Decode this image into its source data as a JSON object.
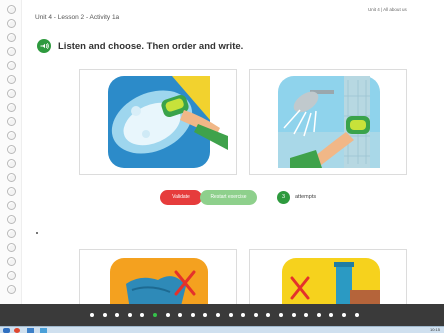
{
  "header": {
    "breadcrumb": "Unit 4 - Lesson 2 - Activity 1a",
    "unit_link": "Unit 4 | All about us"
  },
  "instruction": {
    "text": "Listen and choose.  Then order and write."
  },
  "controls": {
    "validate_label": "Validate",
    "restart_label": "Restart exercise",
    "attempts_count": "3",
    "attempts_label": "attempts"
  },
  "cards": [
    {
      "image": "washing-hands-at-sink",
      "background": "#2c8bc9"
    },
    {
      "image": "taking-a-shower",
      "background": "#8fd3ec"
    },
    {
      "image": "crossed-out-messy-clothes",
      "background": "#f4a11f"
    },
    {
      "image": "crossed-out-towel",
      "background": "#f6d21d"
    }
  ],
  "pagination": {
    "total": 22,
    "active": 5
  },
  "taskbar": {
    "clock": "10:15"
  },
  "colors": {
    "accent_green": "#2e9a3e",
    "validate_red": "#e63c3c",
    "restart_green": "#8ed08c",
    "nav_bar": "#3a3a3a",
    "active_dot": "#35c24a"
  }
}
